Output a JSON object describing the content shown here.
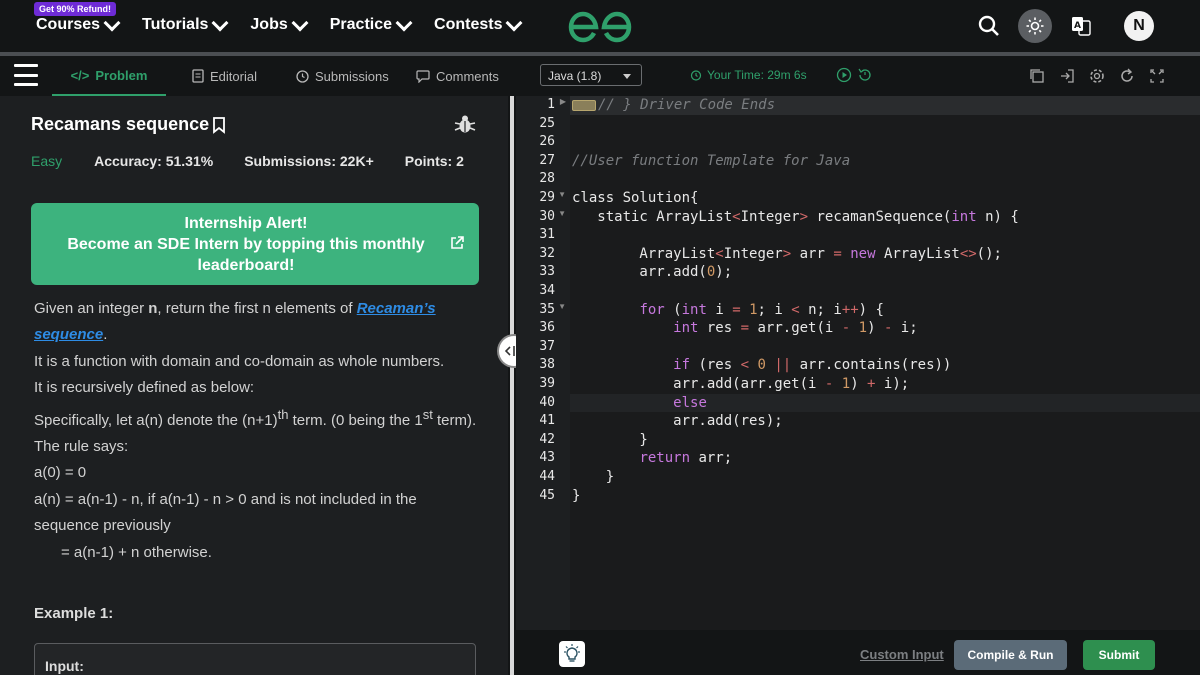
{
  "nav": {
    "refund_badge": "Get 90% Refund!",
    "items": [
      "Courses",
      "Tutorials",
      "Jobs",
      "Practice",
      "Contests"
    ],
    "avatar_initial": "N"
  },
  "tabs": [
    "Problem",
    "Editorial",
    "Submissions",
    "Comments"
  ],
  "problem": {
    "title": "Recamans sequence",
    "difficulty": "Easy",
    "accuracy": "Accuracy: 51.31%",
    "submissions": "Submissions: 22K+",
    "points": "Points: 2"
  },
  "alert": {
    "line1": "Internship Alert!",
    "line2": "Become an SDE Intern by topping this monthly leaderboard!"
  },
  "description": {
    "p1_a": "Given an integer ",
    "p1_n": "n",
    "p1_b": ", return the first n elements of ",
    "p1_link": "Recaman’s sequence",
    "p1_c": ".",
    "p2": "It is a function with domain and co-domain as whole numbers.",
    "p3": "It is recursively defined as below:",
    "p4_a": "Specifically, let a(n) denote the (n+1)",
    "p4_sup1": "th",
    "p4_b": " term. (0 being the 1",
    "p4_sup2": "st",
    "p4_c": " term).",
    "p5": "The rule says:",
    "p6": "a(0) = 0",
    "p7": "a(n) = a(n-1) - n, if a(n-1) - n > 0 and is not included in the sequence previously",
    "p8": "= a(n-1) + n otherwise.",
    "example_title": "Example 1:",
    "input_label": "Input:"
  },
  "editor": {
    "language": "Java (1.8)",
    "timer": "Your Time: 29m 6s",
    "line_numbers": [
      "1",
      "25",
      "26",
      "27",
      "28",
      "29",
      "30",
      "31",
      "32",
      "33",
      "34",
      "35",
      "36",
      "37",
      "38",
      "39",
      "40",
      "41",
      "42",
      "43",
      "44",
      "45"
    ],
    "custom_input": "Custom Input",
    "compile_run": "Compile & Run",
    "submit": "Submit"
  },
  "colors": {
    "accent_green": "#2fa06b",
    "alert_green": "#3db37e",
    "submit_green": "#2e8f4f",
    "link_blue": "#2e8ce5"
  }
}
